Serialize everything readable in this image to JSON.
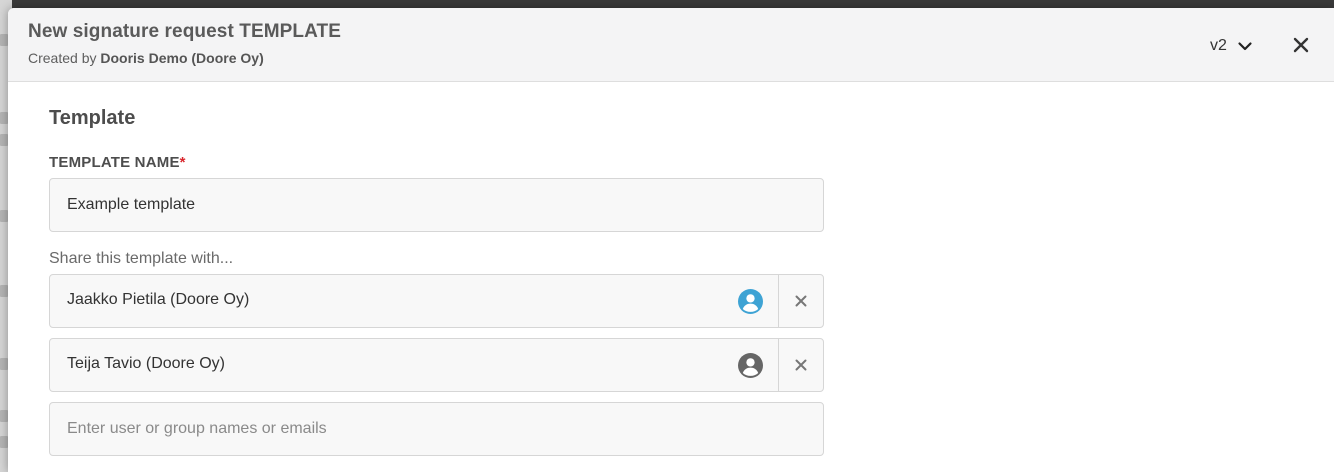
{
  "modal": {
    "title": "New signature request TEMPLATE",
    "created_by_prefix": "Created by",
    "created_by_name": "Dooris Demo (Doore Oy)",
    "version": "v2"
  },
  "template_section": {
    "heading": "Template",
    "name_label": "TEMPLATE NAME",
    "required_marker": "*",
    "name_value": "Example template"
  },
  "sharing": {
    "label": "Share this template with...",
    "users": [
      {
        "name": "Jaakko Pietila (Doore Oy)",
        "avatar_icon": "user-circle-icon",
        "avatar_color": "#3ea3d4"
      },
      {
        "name": "Teija Tavio (Doore Oy)",
        "avatar_icon": "user-circle-icon",
        "avatar_color": "#666666"
      }
    ],
    "search_placeholder": "Enter user or group names or emails"
  },
  "colors": {
    "required": "#d9262c",
    "header_bg": "#f4f4f5"
  }
}
